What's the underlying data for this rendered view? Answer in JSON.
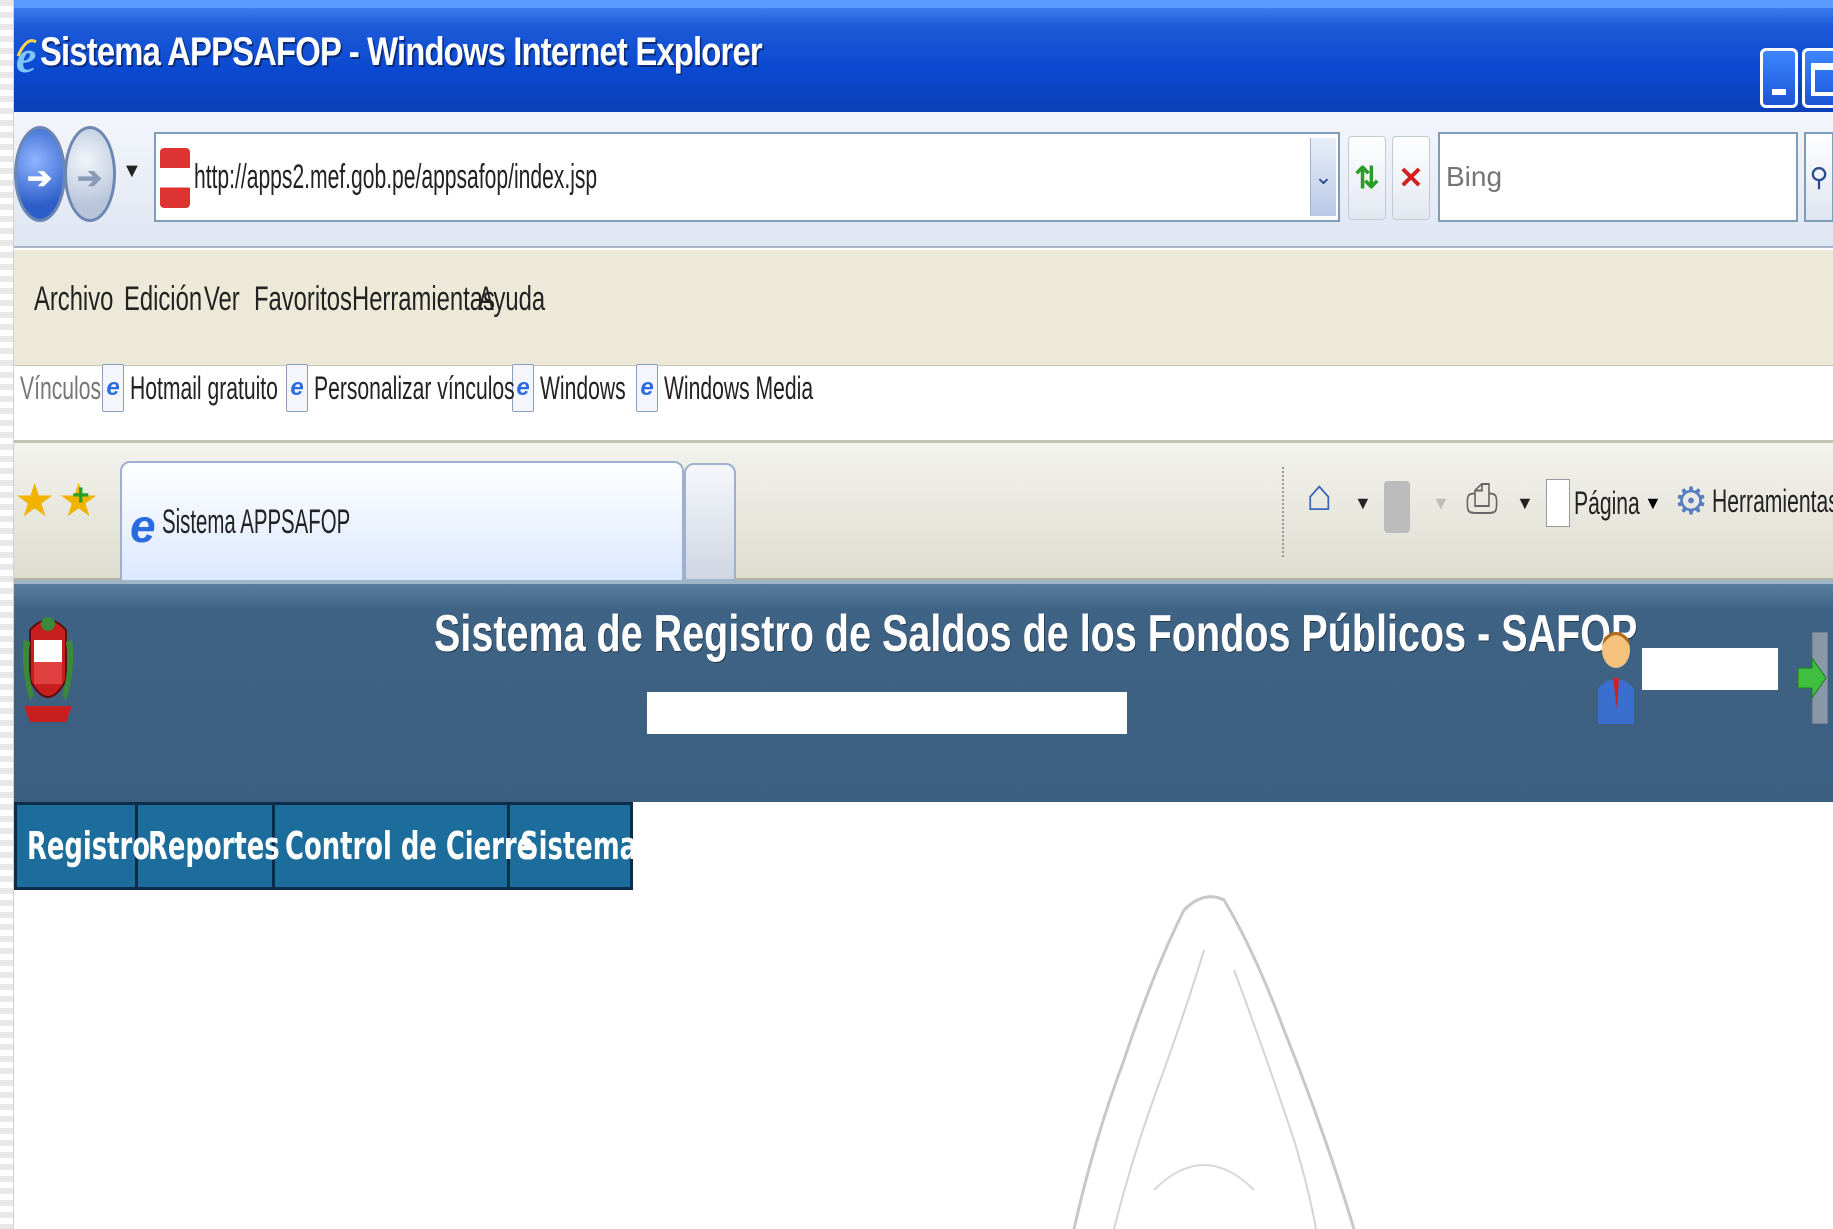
{
  "window": {
    "title": "Sistema APPSAFOP - Windows Internet Explorer"
  },
  "address_bar": {
    "url": "http://apps2.mef.gob.pe/appsafop/index.jsp",
    "search_placeholder": "Bing"
  },
  "menu_bar": {
    "items": [
      "Archivo",
      "Edición",
      "Ver",
      "Favoritos",
      "Herramientas",
      "Ayuda"
    ]
  },
  "links_bar": {
    "label": "Vínculos",
    "items": [
      "Hotmail gratuito",
      "Personalizar vínculos",
      "Windows",
      "Windows Media"
    ]
  },
  "tabs": {
    "active_tab": "Sistema APPSAFOP"
  },
  "command_bar": {
    "page_label": "Página",
    "tools_label": "Herramientas"
  },
  "app": {
    "title": "Sistema de Registro de Saldos de los Fondos Públicos - SAFOP",
    "main_menu": [
      "Registro",
      "Reportes",
      "Control de Cierre",
      "Sistema"
    ]
  },
  "colors": {
    "titlebar": "#0a49d0",
    "header_band": "#3c5f80",
    "menu_item": "#1c6d9b"
  }
}
